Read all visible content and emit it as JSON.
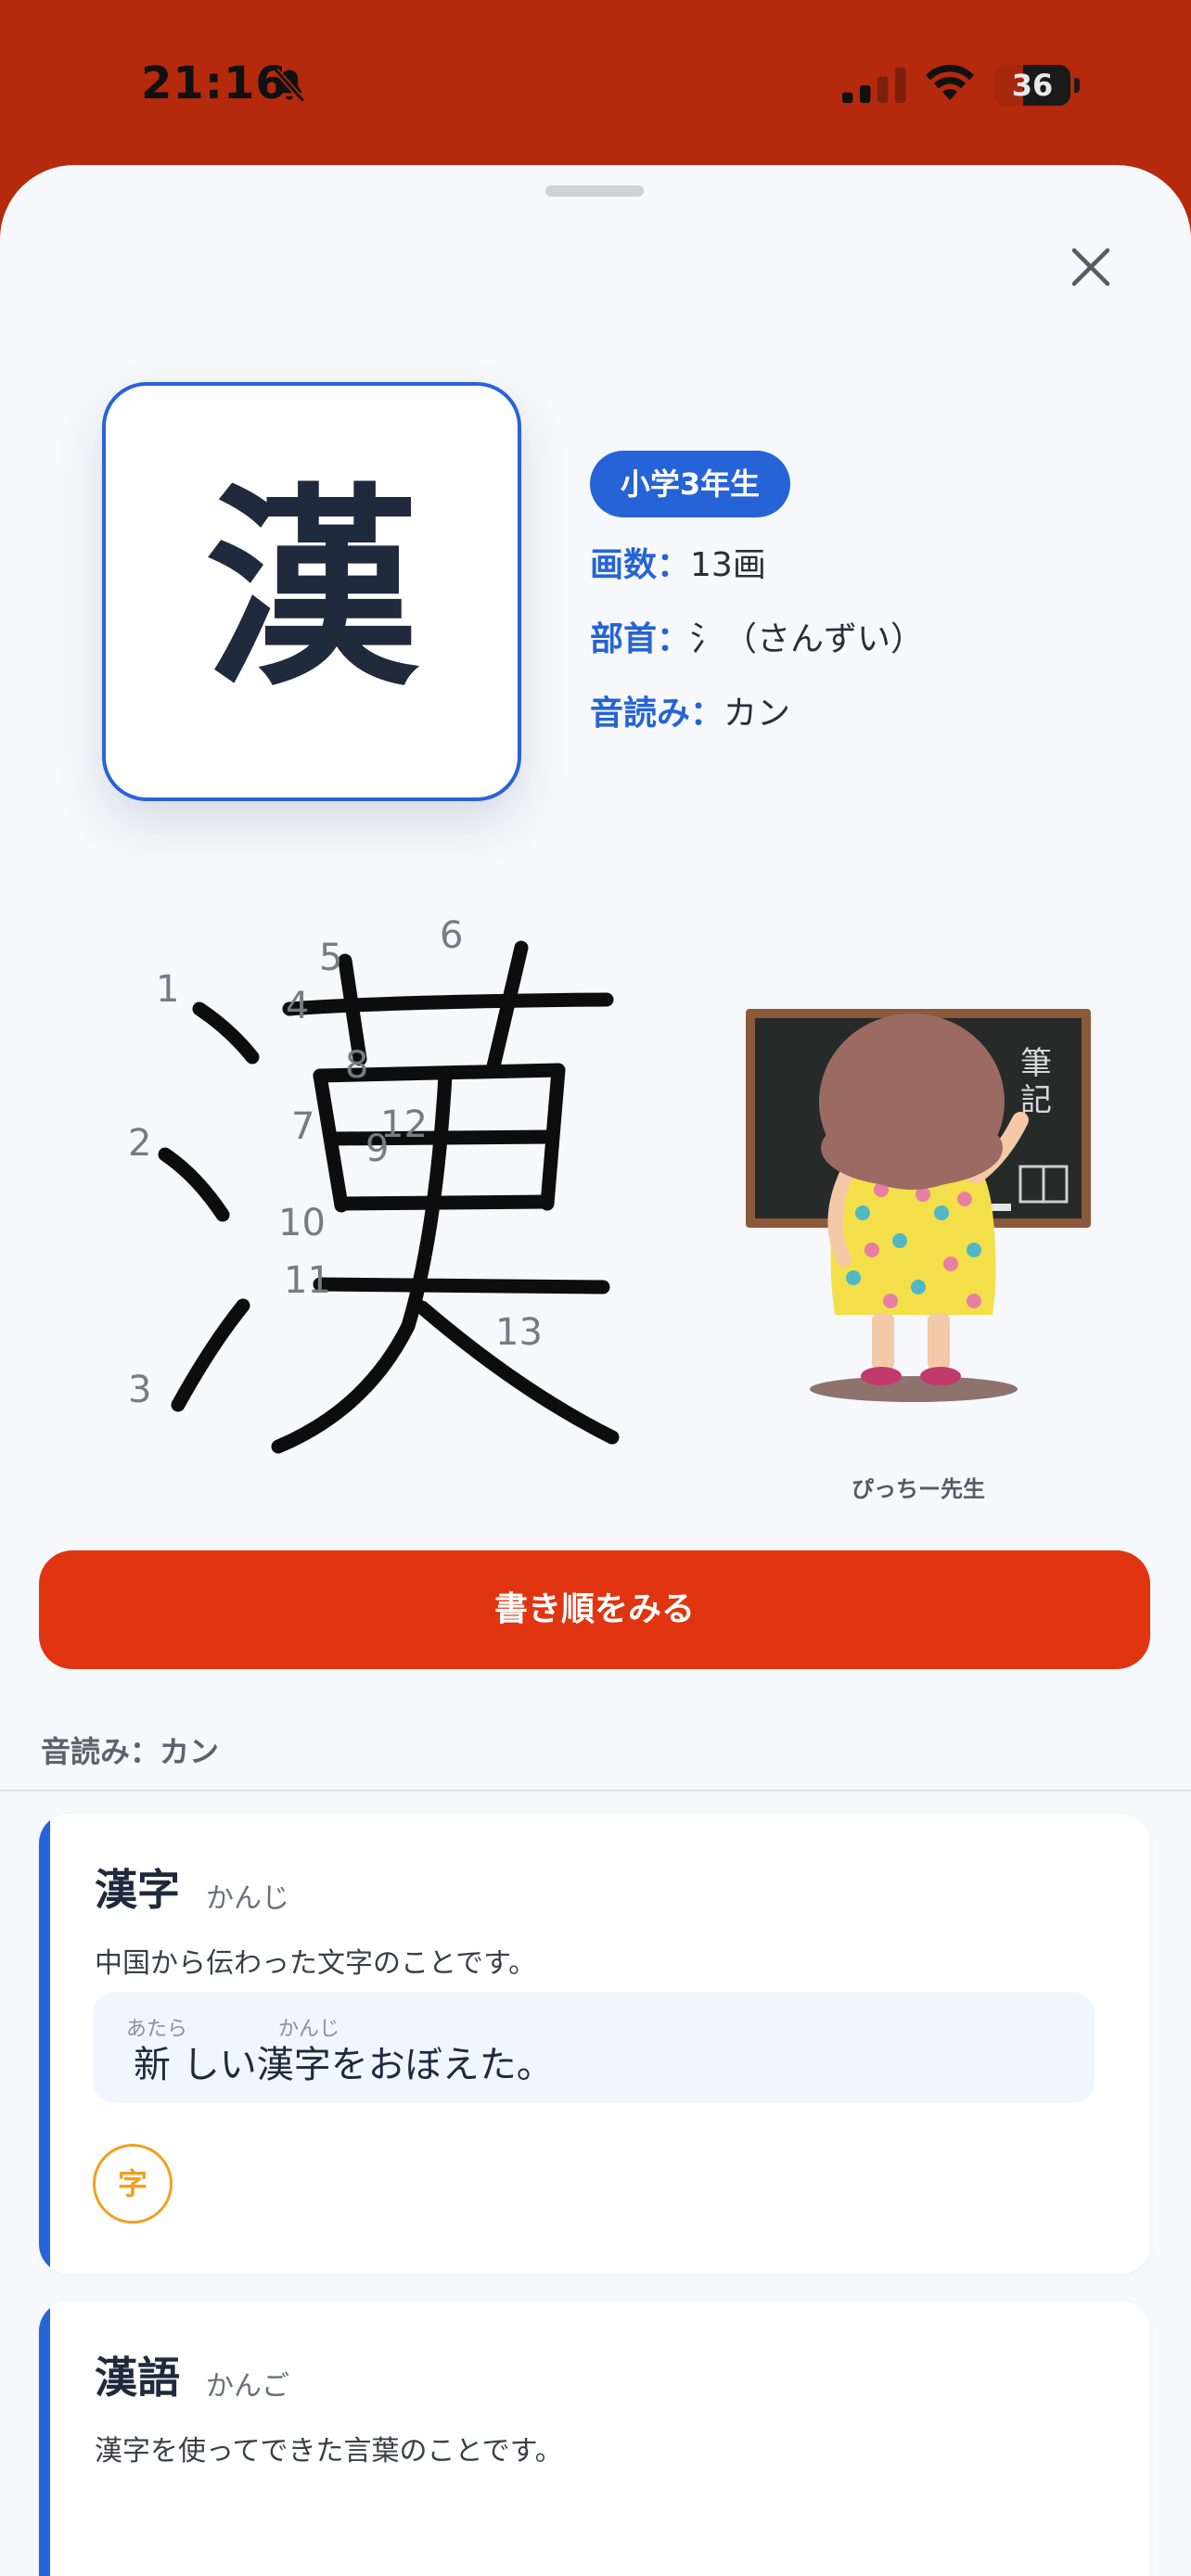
{
  "status_bar": {
    "time": "21:16",
    "battery": "36",
    "battery_level": 0.36,
    "icons": [
      "bell-slash-icon",
      "cellular-signal-icon",
      "wifi-icon",
      "battery-icon"
    ]
  },
  "kanji": {
    "character": "漢",
    "grade": "小学3年生",
    "strokes_label": "画数：",
    "strokes_value": "13画",
    "radical_label": "部首：",
    "radical_value": "氵（さんずい）",
    "onyomi_label": "音読み：",
    "onyomi_value": "カン"
  },
  "stroke_numbers": [
    "1",
    "2",
    "3",
    "4",
    "5",
    "6",
    "7",
    "8",
    "9",
    "10",
    "11",
    "12",
    "13"
  ],
  "character": {
    "caption": "ぴっちー先生",
    "board_text": "筆記"
  },
  "buttons": {
    "stroke_order": "書き順をみる",
    "close_icon": "close-icon"
  },
  "section": {
    "label": "音読み：カン"
  },
  "words": [
    {
      "word": "漢字",
      "reading": "かんじ",
      "definition": "中国から伝わった文字のことです。",
      "example": "新 しい漢字をおぼえた。",
      "ruby": [
        "あたら",
        "かんじ"
      ],
      "chip": "字"
    },
    {
      "word": "漢語",
      "reading": "かんご",
      "definition": "漢字を使ってできた言葉のことです。"
    }
  ],
  "colors": {
    "header_red": "#b5290c",
    "accent_blue": "#2563d6",
    "button_red": "#e03510",
    "chip_orange": "#f0a020"
  }
}
